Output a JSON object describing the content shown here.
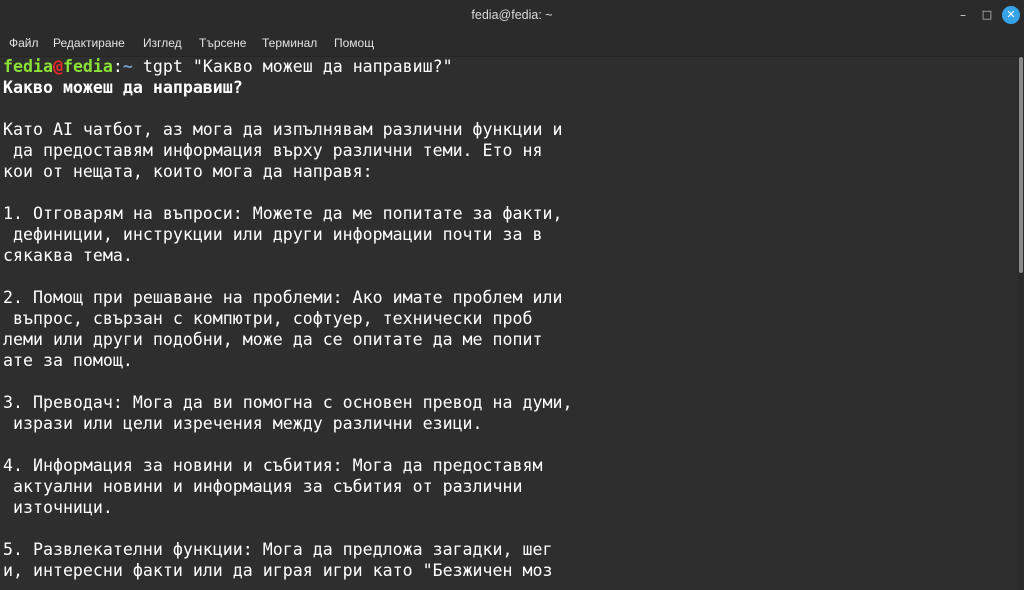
{
  "window": {
    "title": "fedia@fedia: ~",
    "controls": {
      "minimize_glyph": "–",
      "maximize_glyph": "□",
      "close_glyph": "✕",
      "close_color": "#35a3e8"
    }
  },
  "menubar": {
    "items": [
      "Файл",
      "Редактиране",
      "Изглед",
      "Търсене",
      "Терминал",
      "Помощ"
    ]
  },
  "terminal": {
    "prompt": {
      "user": "fedia",
      "at": "@",
      "host": "fedia",
      "colon": ":",
      "path": "~",
      "command": " tgpt \"Какво можеш да направиш?\""
    },
    "question_echo": "Какво можеш да направиш?",
    "lines": [
      "",
      "Като AI чатбот, аз мога да изпълнявам различни функции и",
      " да предоставям информация върху различни теми. Ето ня",
      "кои от нещата, които мога да направя:",
      "",
      "1. Отговарям на въпроси: Можете да ме попитате за факти,",
      " дефиниции, инструкции или други информации почти за в",
      "сякаква тема.",
      "",
      "2. Помощ при решаване на проблеми: Ако имате проблем или",
      " въпрос, свързан с компютри, софтуер, технически проб",
      "леми или други подобни, може да се опитате да ме попит",
      "ате за помощ.",
      "",
      "3. Преводач: Мога да ви помогна с основен превод на думи,",
      " изрази или цели изречения между различни езици.",
      "",
      "4. Информация за новини и събития: Мога да предоставям",
      " актуални новини и информация за събития от различни",
      " източници.",
      "",
      "5. Развлекателни функции: Мога да предложа загадки, шег",
      "и, интересни факти или да играя игри като \"Безжичен моз"
    ],
    "colors": {
      "background": "#2e2e2e",
      "foreground": "#ffffff",
      "user": "#8ae234",
      "at": "#ef2929",
      "path": "#729fcf"
    }
  }
}
